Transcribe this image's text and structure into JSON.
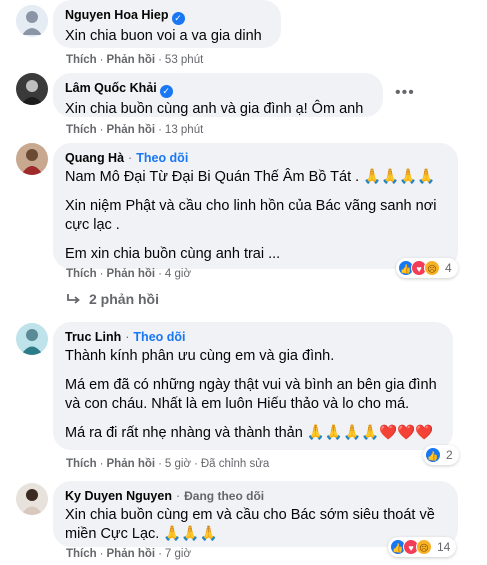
{
  "comments": [
    {
      "name": "Nguyen Hoa Hiep",
      "text": [
        "Xin chia buon voi a va gia dinh"
      ],
      "like": "Thích",
      "reply": "Phản hồi",
      "time": "53 phút"
    },
    {
      "name": "Lâm Quốc Khải",
      "text": [
        "Xin chia buồn cùng anh và gia đình ạ! Ôm anh"
      ],
      "like": "Thích",
      "reply": "Phản hồi",
      "time": "13 phút"
    },
    {
      "name": "Quang Hà",
      "follow": "Theo dõi",
      "text": [
        "Nam Mô Đại Từ Đại Bi Quán Thế Âm Bồ Tát . 🙏🙏🙏🙏",
        "Xin niệm Phật và cầu cho linh hồn của Bác vãng sanh nơi cực lạc .",
        "Em xin chia buồn cùng anh trai ..."
      ],
      "like": "Thích",
      "reply": "Phản hồi",
      "time": "4 giờ",
      "reaction_count": "4",
      "replies_label": "2 phản hồi"
    },
    {
      "name": "Truc Linh",
      "follow": "Theo dõi",
      "text": [
        "Thành kính phân ưu cùng em và gia đình.",
        "Má em đã có những ngày thật vui và bình an bên gia đình và con cháu. Nhất là em luôn Hiếu thảo và lo cho má.",
        "Má ra đi rất nhẹ nhàng và thành thản 🙏🙏🙏🙏❤️❤️❤️"
      ],
      "like": "Thích",
      "reply": "Phản hồi",
      "time": "5 giờ",
      "edited": "Đã chỉnh sửa",
      "reaction_count": "2"
    },
    {
      "name": "Ky Duyen Nguyen",
      "following": "Đang theo dõi",
      "text": [
        "Xin chia buồn cùng em và cầu cho Bác sớm siêu thoát về miền Cực Lạc. 🙏🙏🙏"
      ],
      "like": "Thích",
      "reply": "Phản hồi",
      "time": "7 giờ",
      "reaction_count": "14"
    }
  ],
  "icons": {
    "verified": "verified-badge-icon",
    "more": "more-options-icon",
    "reply_arrow": "reply-arrow-icon",
    "like": "like-reaction-icon",
    "love": "love-reaction-icon",
    "sad": "sad-reaction-icon"
  },
  "colors": {
    "bubble": "#f0f2f5",
    "secondary_text": "#65676b",
    "accent": "#1877f2"
  }
}
